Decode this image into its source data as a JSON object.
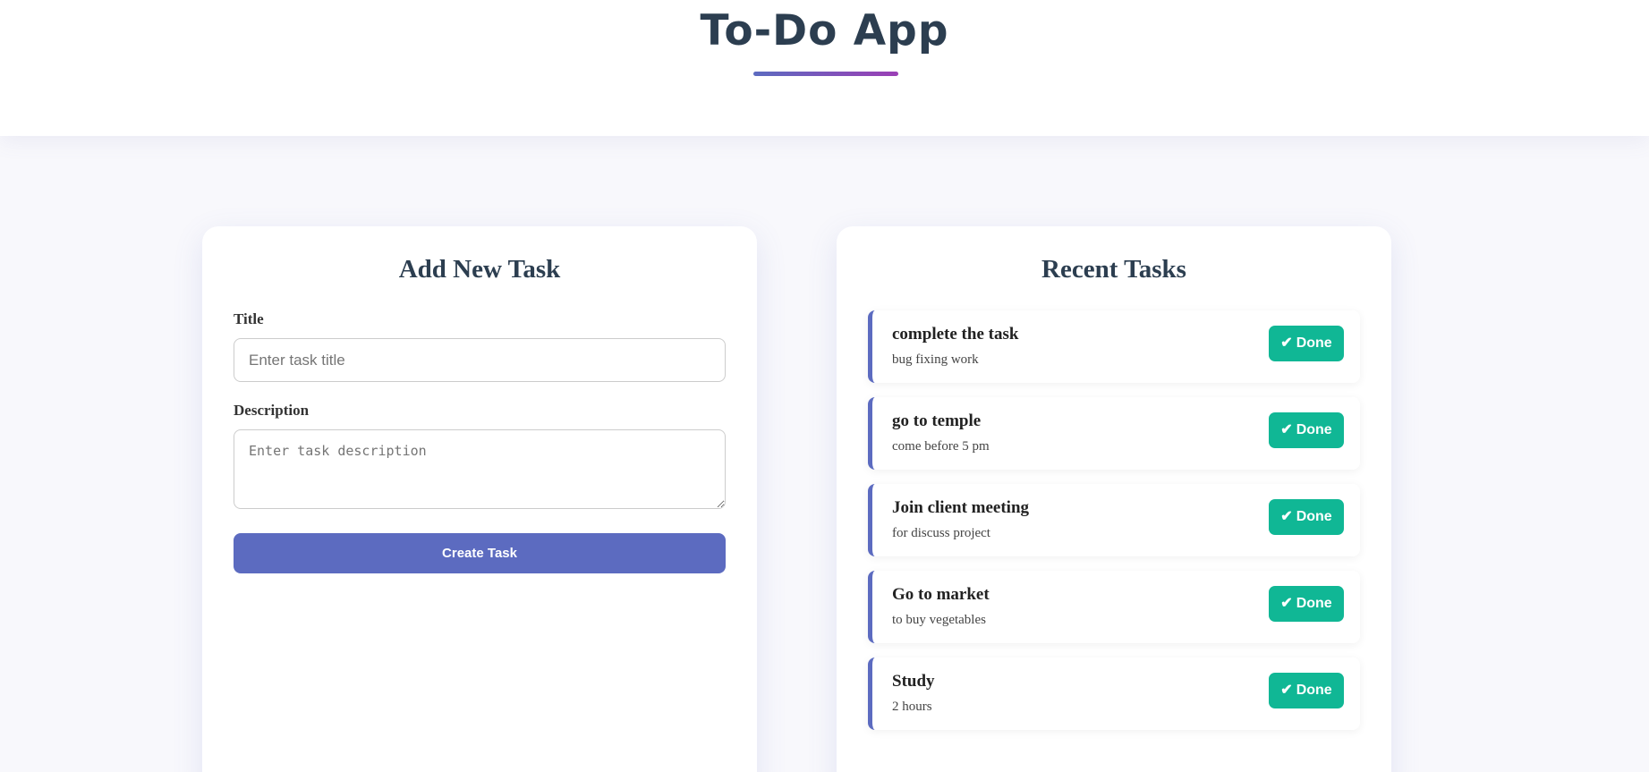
{
  "header": {
    "title": "To-Do App"
  },
  "add_task": {
    "heading": "Add New Task",
    "title_label": "Title",
    "title_placeholder": "Enter task title",
    "title_value": "",
    "description_label": "Description",
    "description_placeholder": "Enter task description",
    "description_value": "",
    "create_label": "Create Task"
  },
  "recent_tasks": {
    "heading": "Recent Tasks",
    "done_label": "Done",
    "done_icon": "check-icon",
    "items": [
      {
        "title": "complete the task",
        "description": "bug fixing work"
      },
      {
        "title": "go to temple",
        "description": "come before 5 pm"
      },
      {
        "title": "Join client meeting",
        "description": "for discuss project"
      },
      {
        "title": "Go to market",
        "description": "to buy vegetables"
      },
      {
        "title": "Study",
        "description": "2 hours"
      }
    ]
  },
  "colors": {
    "accent": "#5c6bc0",
    "gradient_end": "#9b3fb5",
    "done_button": "#10b795",
    "heading_text": "#2c3e50"
  }
}
